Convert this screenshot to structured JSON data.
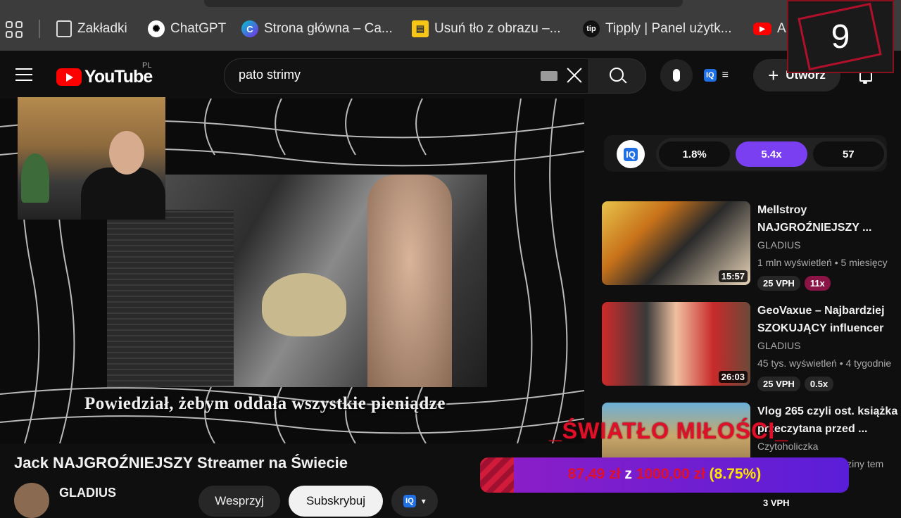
{
  "bookmarks": [
    {
      "label": "Zakładki",
      "icon": "bookmark-icon"
    },
    {
      "label": "ChatGPT",
      "icon": "chatgpt-icon"
    },
    {
      "label": "Strona główna – Ca...",
      "icon": "canva-icon"
    },
    {
      "label": "Usuń tło z obrazu –...",
      "icon": "remove-bg-icon"
    },
    {
      "label": "Tipply | Panel użytk...",
      "icon": "tipply-icon"
    },
    {
      "label": "A",
      "icon": "youtube-icon"
    }
  ],
  "overlay_counter": "9",
  "header": {
    "logo_text": "YouTube",
    "region": "PL",
    "search_value": "pato strimy",
    "create_label": "Utwórz"
  },
  "video": {
    "subtitle": "Powiedział,  żebym oddała wszystkie pieniądze",
    "title": "Jack NAJGROŹNIEJSZY Streamer na Świecie",
    "channel": "GLADIUS",
    "support_label": "Wesprzyj",
    "subscribe_label": "Subskrybuj"
  },
  "iq_stats": [
    "1.8%",
    "5.4x",
    "57"
  ],
  "recommendations": [
    {
      "title": "Mellstroy\nNAJGROŹNIEJSZY ...",
      "channel": "GLADIUS",
      "meta": "1 mln wyświetleń • 5 miesięcy",
      "duration": "15:57",
      "tags": [
        "25 VPH",
        "11x"
      ]
    },
    {
      "title": "GeoVaxue – Najbardziej\nSZOKUJĄCY influencer",
      "channel": "GLADIUS",
      "meta": "45 tys. wyświetleń • 4 tygodnie",
      "duration": "26:03",
      "tags": [
        "25 VPH",
        "0.5x"
      ]
    },
    {
      "title": "Vlog 265 czyli ost. książka\nprzeczytana przed ...",
      "channel": "Czytoholiczka",
      "meta": "1 wyświetleń • 4 godziny tem",
      "duration": "",
      "tags": [
        "3 VPH"
      ]
    }
  ],
  "donation": {
    "title": "_ŚWIATŁO MIŁOŚCI_",
    "amount": "87,49 zł",
    "sep": "z",
    "goal": "1000,00 zł",
    "percent": "(8.75%)",
    "progress_fraction": 0.0875
  }
}
